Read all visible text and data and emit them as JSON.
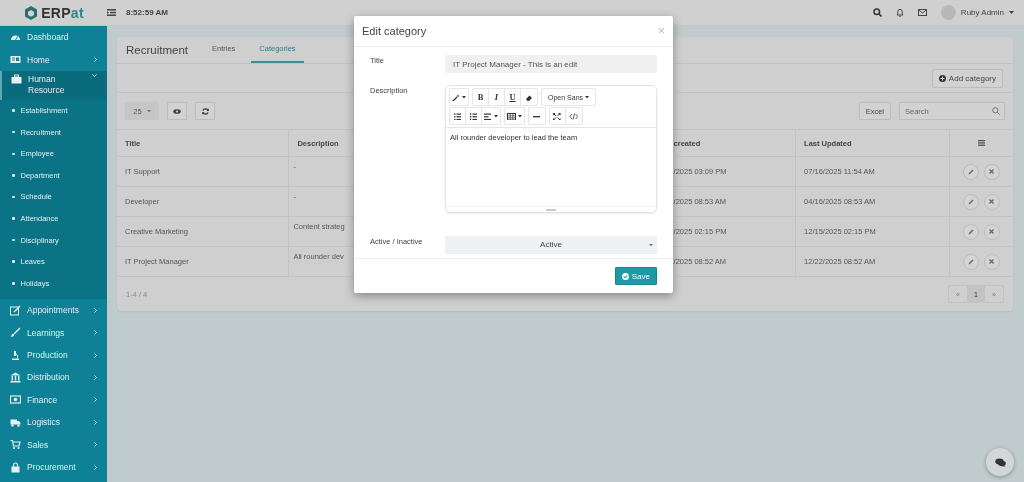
{
  "topbar": {
    "logo": "ERPat",
    "time": "8:52:59 AM",
    "user": "Ruby Admin"
  },
  "sidebar": {
    "items": [
      {
        "label": "Dashboard"
      },
      {
        "label": "Home",
        "expanded": false
      },
      {
        "label": "Human Resource",
        "expanded": true,
        "children": [
          {
            "label": "Establishment"
          },
          {
            "label": "Recruitment"
          },
          {
            "label": "Employee"
          },
          {
            "label": "Department"
          },
          {
            "label": "Schedule"
          },
          {
            "label": "Attendance"
          },
          {
            "label": "Disciplinary"
          },
          {
            "label": "Leaves"
          },
          {
            "label": "Holidays"
          }
        ]
      },
      {
        "label": "Appointments",
        "expanded": false
      },
      {
        "label": "Learnings",
        "expanded": false
      },
      {
        "label": "Production",
        "expanded": false
      },
      {
        "label": "Distribution",
        "expanded": false
      },
      {
        "label": "Finance",
        "expanded": false
      },
      {
        "label": "Logistics",
        "expanded": false
      },
      {
        "label": "Sales",
        "expanded": false
      },
      {
        "label": "Procurement",
        "expanded": false
      }
    ]
  },
  "page": {
    "title": "Recruitment",
    "tabs": [
      {
        "label": "Entries",
        "selected": false
      },
      {
        "label": "Categories",
        "selected": true
      }
    ],
    "add_button": "Add category",
    "page_size": "25",
    "excel_button": "Excel",
    "search": {
      "placeholder": "Search"
    },
    "table": {
      "columns": [
        "Title",
        "Description",
        "created",
        "Last Updated"
      ],
      "rows": [
        [
          "IT Support",
          "-",
          "/2025 03:09 PM",
          "07/16/2025 11:54 AM"
        ],
        [
          "Developer",
          "-",
          "/2025 08:53 AM",
          "04/16/2025 08:53 AM"
        ],
        [
          "Creative Marketing",
          "Content strateg",
          "/2025 02:15 PM",
          "12/15/2025 02:15 PM"
        ],
        [
          "IT Project Manager",
          "All rounder dev",
          "/2025 08:52 AM",
          "12/22/2025 08:52 AM"
        ]
      ]
    },
    "info": "1-4 / 4",
    "pagination": [
      {
        "label": "«",
        "selected": false
      },
      {
        "label": "1",
        "selected": true
      },
      {
        "label": "»",
        "selected": false
      }
    ]
  },
  "modal": {
    "title": "Edit category",
    "close": "×",
    "title_label": "Title",
    "title_value": "IT Project Manager - This is an edit",
    "description_label": "Description",
    "toolbar": [
      [
        [
          {
            "kind": "magic"
          }
        ],
        [
          {
            "kind": "text",
            "label": "B"
          },
          {
            "kind": "text",
            "label": "I"
          },
          {
            "kind": "text",
            "label": "U"
          },
          {
            "kind": "eraser"
          }
        ],
        [
          {
            "kind": "font",
            "label": "Open Sans"
          }
        ]
      ],
      [
        [
          {
            "kind": "ul"
          },
          {
            "kind": "ol"
          },
          {
            "kind": "align"
          }
        ],
        [
          {
            "kind": "table"
          }
        ],
        [
          {
            "kind": "hr"
          }
        ],
        [
          {
            "kind": "fullscreen"
          },
          {
            "kind": "code"
          }
        ]
      ]
    ],
    "description": "All rounder developer to lead the team",
    "status_label": "Active / Inactive",
    "status_value": "Active",
    "save": "Save"
  }
}
